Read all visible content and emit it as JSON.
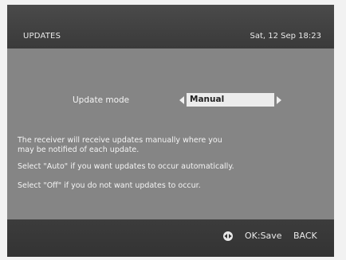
{
  "header": {
    "title": "UPDATES",
    "datetime": "Sat, 12 Sep 18:23"
  },
  "setting": {
    "label": "Update mode",
    "value": "Manual"
  },
  "description": {
    "line1": "The receiver will receive updates manually where you",
    "line2": "may be notified of each update.",
    "line3": "Select \"Auto\" if you want updates to occur automatically.",
    "line4": "Select \"Off\" if you do not want updates to occur."
  },
  "footer": {
    "nav_icon": "left-right-arrows-icon",
    "ok_label": "OK:Save",
    "back_label": "BACK"
  }
}
